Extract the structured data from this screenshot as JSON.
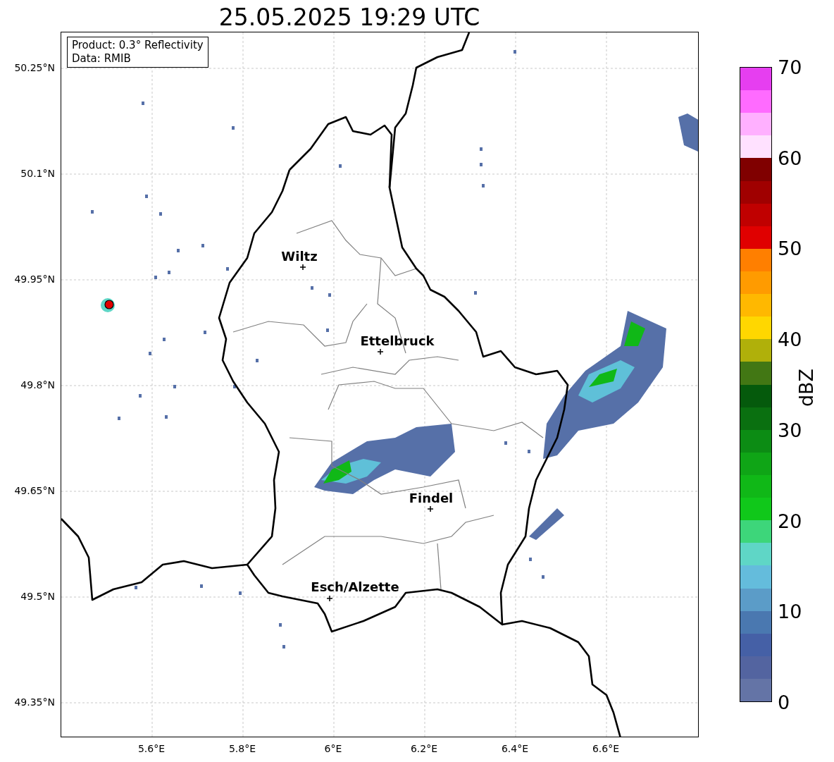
{
  "title": "25.05.2025 19:29 UTC",
  "info_box": {
    "lines": [
      "Product: 0.3° Reflectivity",
      "Data: RMIB"
    ]
  },
  "map": {
    "cities": [
      {
        "name": "Wiltz"
      },
      {
        "name": "Ettelbruck"
      },
      {
        "name": "Findel"
      },
      {
        "name": "Esch/Alzette"
      }
    ],
    "y_ticks": [
      "50.25°N",
      "50.1°N",
      "49.95°N",
      "49.8°N",
      "49.65°N",
      "49.5°N",
      "49.35°N"
    ],
    "x_ticks": [
      "5.6°E",
      "5.8°E",
      "6°E",
      "6.2°E",
      "6.4°E",
      "6.6°E"
    ]
  },
  "colorbar": {
    "label": "dBZ",
    "ticks": [
      "70",
      "60",
      "50",
      "40",
      "30",
      "20",
      "10",
      "0"
    ],
    "segments": [
      {
        "color": "#e63ef0"
      },
      {
        "color": "#ff6bff"
      },
      {
        "color": "#ffb0ff"
      },
      {
        "color": "#ffe1ff"
      },
      {
        "color": "#800000"
      },
      {
        "color": "#a00000"
      },
      {
        "color": "#c00000"
      },
      {
        "color": "#e00000"
      },
      {
        "color": "#ff7f00"
      },
      {
        "color": "#ff9b00"
      },
      {
        "color": "#ffb800"
      },
      {
        "color": "#ffd700"
      },
      {
        "color": "#b0b00a"
      },
      {
        "color": "#427714"
      },
      {
        "color": "#055a0c"
      },
      {
        "color": "#0a7010"
      },
      {
        "color": "#0c8c14"
      },
      {
        "color": "#0fa516"
      },
      {
        "color": "#10b817"
      },
      {
        "color": "#10c81a"
      },
      {
        "color": "#3dd67a"
      },
      {
        "color": "#5fd6c6"
      },
      {
        "color": "#64bcdc"
      },
      {
        "color": "#5b9cc8"
      },
      {
        "color": "#4a78b0"
      },
      {
        "color": "#4560a6"
      },
      {
        "color": "#5364a0"
      },
      {
        "color": "#6474a6"
      }
    ]
  }
}
